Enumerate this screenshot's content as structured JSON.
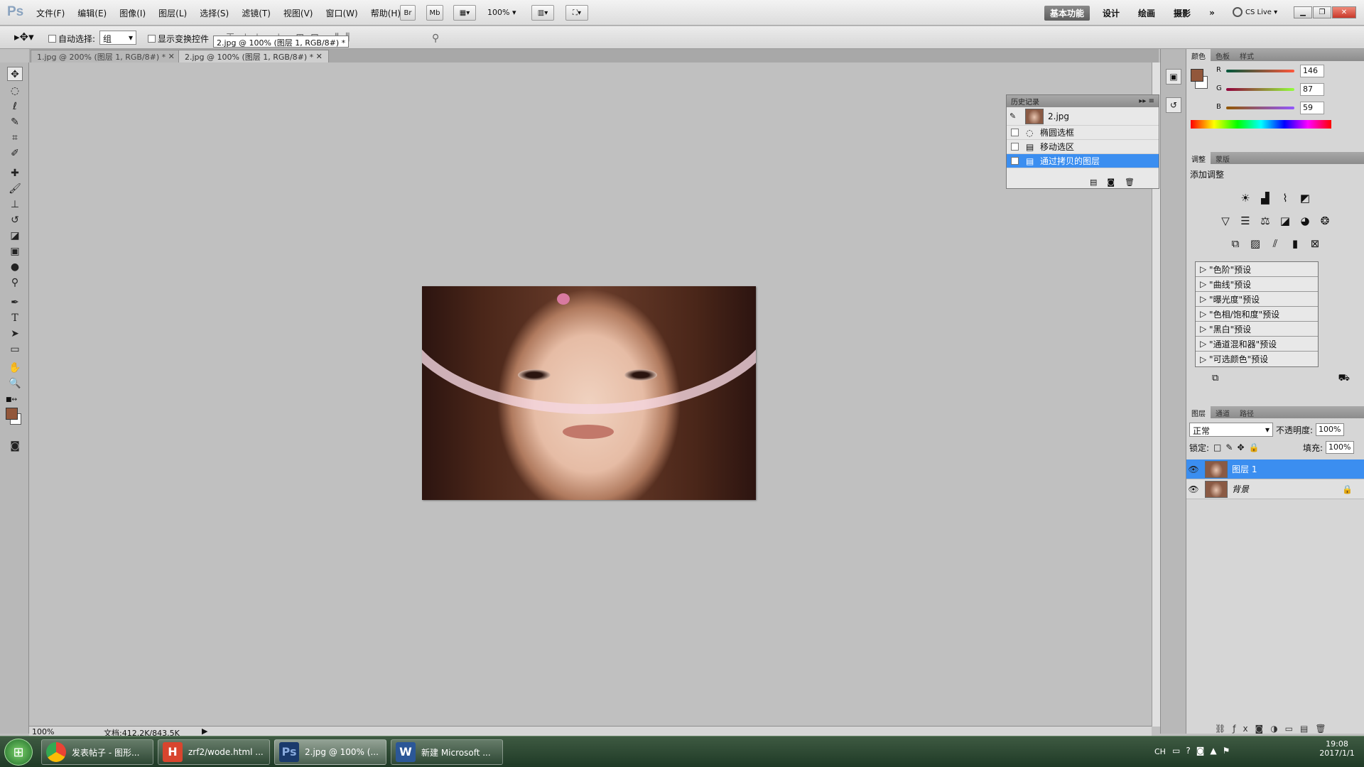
{
  "app": {
    "logo": "Ps"
  },
  "menu": [
    "文件(F)",
    "编辑(E)",
    "图像(I)",
    "图层(L)",
    "选择(S)",
    "滤镜(T)",
    "视图(V)",
    "窗口(W)",
    "帮助(H)"
  ],
  "appbar": {
    "bridge": "Br",
    "minibridge": "Mb",
    "zoom": "100%"
  },
  "workspaces": [
    "基本功能",
    "设计",
    "绘画",
    "摄影"
  ],
  "more_ws": "»",
  "cslive": "CS Live",
  "options": {
    "auto_select": "自动选择:",
    "auto_select_value": "组",
    "show_transform": "显示变换控件"
  },
  "tooltip": "2.jpg @ 100% (图层 1, RGB/8#) *",
  "tabs": [
    {
      "label": "1.jpg @ 200% (图层 1, RGB/8#) *"
    },
    {
      "label": "2.jpg @ 100% (图层 1, RGB/8#) *"
    }
  ],
  "status": {
    "zoom": "100%",
    "doc": "文档:412.2K/843.5K"
  },
  "history": {
    "title": "历史记录",
    "snapshot": "2.jpg",
    "items": [
      "椭圆选框",
      "移动选区",
      "通过拷贝的图层"
    ]
  },
  "color_panel": {
    "tabs": [
      "颜色",
      "色板",
      "样式"
    ],
    "r_label": "R",
    "g_label": "G",
    "b_label": "B",
    "r": 146,
    "g": 87,
    "b": 59,
    "fg_color": "#92573b"
  },
  "adjust_panel": {
    "tabs": [
      "调整",
      "蒙版"
    ],
    "title": "添加调整",
    "presets": [
      "\"色阶\"预设",
      "\"曲线\"预设",
      "\"曝光度\"预设",
      "\"色相/饱和度\"预设",
      "\"黑白\"预设",
      "\"通道混和器\"预设",
      "\"可选颜色\"预设"
    ]
  },
  "layers_panel": {
    "tabs": [
      "图层",
      "通道",
      "路径"
    ],
    "blend_mode": "正常",
    "opacity_label": "不透明度:",
    "opacity": "100%",
    "lock_label": "锁定:",
    "fill_label": "填充:",
    "fill": "100%",
    "layers": [
      {
        "name": "图层 1",
        "selected": true
      },
      {
        "name": "背景",
        "selected": false
      }
    ]
  },
  "taskbar": {
    "items": [
      {
        "label": "发表帖子 - 图形...",
        "icon": "chrome-icon"
      },
      {
        "label": "zrf2/wode.html ...",
        "icon": "H"
      },
      {
        "label": "2.jpg @ 100% (...",
        "icon": "Ps"
      },
      {
        "label": "新建 Microsoft ...",
        "icon": "W"
      }
    ],
    "lang": "CH",
    "time": "19:08",
    "date": "2017/1/1"
  },
  "colors": {
    "accent": "#3b8ef0",
    "ps_blue": "#1a3a6c"
  }
}
